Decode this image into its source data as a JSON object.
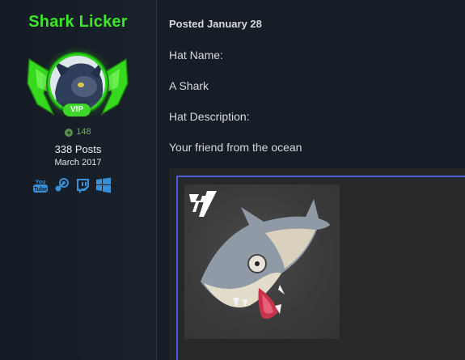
{
  "user": {
    "name": "Shark Licker",
    "badge": "VIP",
    "reputation": "148",
    "posts": "338 Posts",
    "joined": "March 2017",
    "social_icons": [
      "youtube-icon",
      "steam-icon",
      "twitch-icon",
      "windows-icon"
    ]
  },
  "post": {
    "posted": "Posted January 28",
    "lines": [
      "Hat Name:",
      "A Shark",
      "Hat Description:",
      "Your friend from the ocean"
    ],
    "image_logo": "fortnite-logo"
  },
  "colors": {
    "username": "#3ee62a",
    "vip": "#3ed62a",
    "image_border": "#4a5fd6",
    "background": "#161d26"
  }
}
